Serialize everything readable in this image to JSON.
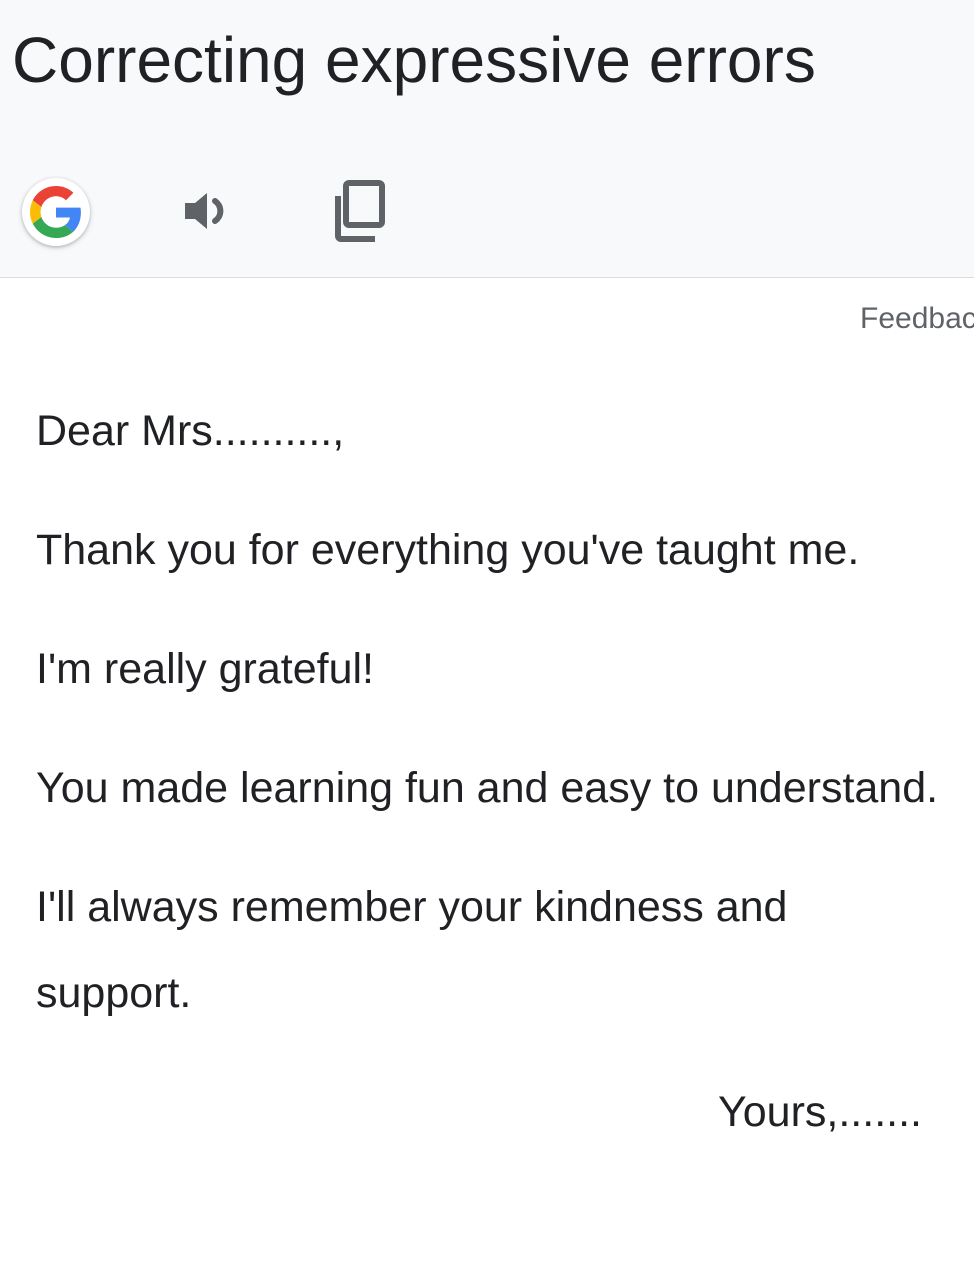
{
  "header": {
    "title": "Correcting expressive errors",
    "tools": [
      {
        "icon": "google-g-icon",
        "action": "google"
      },
      {
        "icon": "speaker-icon",
        "action": "listen"
      },
      {
        "icon": "copy-icon",
        "action": "copy"
      }
    ]
  },
  "content": {
    "feedback_label": "Feedback",
    "letter": {
      "salutation": "Dear Mrs..........,",
      "paragraphs": [
        "Thank you for everything you've taught me.",
        "I'm really grateful!",
        "You made learning fun and easy to understand.",
        "I'll always remember your kindness and support."
      ],
      "signoff": "Yours,......."
    }
  },
  "colors": {
    "header_bg": "#f8f9fa",
    "text": "#202124",
    "muted": "#5f6368",
    "icon": "#5f6368",
    "google_blue": "#4285F4",
    "google_red": "#EA4335",
    "google_yellow": "#FBBC05",
    "google_green": "#34A853"
  }
}
